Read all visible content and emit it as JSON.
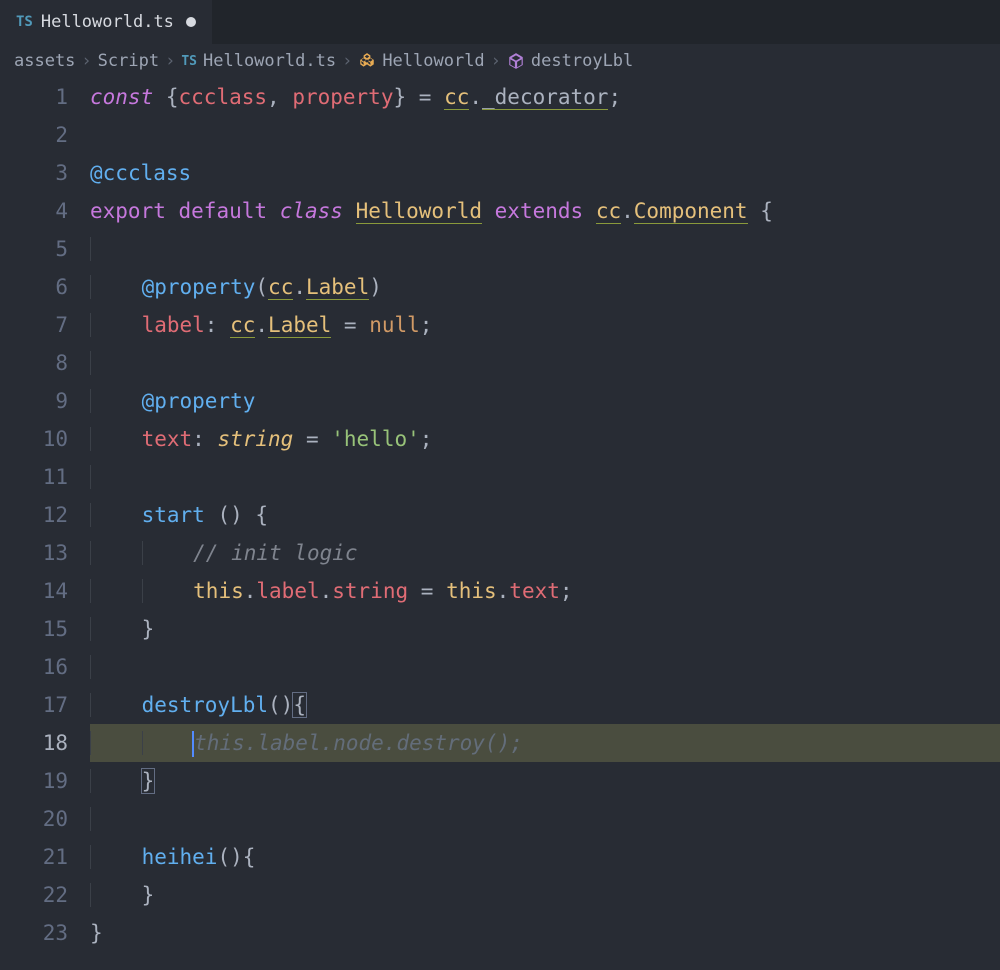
{
  "tab": {
    "badge": "TS",
    "label": "Helloworld.ts",
    "dirty": true
  },
  "breadcrumb": {
    "parts": [
      "assets",
      "Script"
    ],
    "file_badge": "TS",
    "file": "Helloworld.ts",
    "class": "Helloworld",
    "method": "destroyLbl"
  },
  "gutter": {
    "lines": [
      "1",
      "2",
      "3",
      "4",
      "5",
      "6",
      "7",
      "8",
      "9",
      "10",
      "11",
      "12",
      "13",
      "14",
      "15",
      "16",
      "17",
      "18",
      "19",
      "20",
      "21",
      "22",
      "23"
    ],
    "active": 18
  },
  "code": {
    "l1": {
      "const": "const",
      "br_open": " {",
      "ccclass": "ccclass",
      "comma": ", ",
      "property": "property",
      "br_close": "} = ",
      "cc": "cc",
      "dot": ".",
      "dec": "_decorator",
      "semi": ";"
    },
    "l3": {
      "at": "@",
      "ccclass": "ccclass"
    },
    "l4": {
      "export": "export",
      "sp1": " ",
      "default": "default",
      "sp2": " ",
      "class": "class",
      "sp3": " ",
      "name": "Helloworld",
      "sp4": " ",
      "extends": "extends",
      "sp5": " ",
      "cc": "cc",
      "dot": ".",
      "comp": "Component",
      "sp6": " ",
      "brace": "{"
    },
    "l6": {
      "indent": "    ",
      "at": "@",
      "property": "property",
      "open": "(",
      "cc": "cc",
      "dot": ".",
      "label": "Label",
      "close": ")"
    },
    "l7": {
      "indent": "    ",
      "label": "label",
      "colon": ": ",
      "cc": "cc",
      "dot": ".",
      "type": "Label",
      "eq": " = ",
      "null": "null",
      "semi": ";"
    },
    "l9": {
      "indent": "    ",
      "at": "@",
      "property": "property"
    },
    "l10": {
      "indent": "    ",
      "text": "text",
      "colon": ": ",
      "type": "string",
      "eq": " = ",
      "str": "'hello'",
      "semi": ";"
    },
    "l12": {
      "indent": "    ",
      "name": "start",
      "space": " ",
      "parens": "() ",
      "brace": "{"
    },
    "l13": {
      "indent": "        ",
      "comment": "// init logic"
    },
    "l14": {
      "indent": "        ",
      "this": "this",
      "dot1": ".",
      "label": "label",
      "dot2": ".",
      "string": "string",
      "eq": " = ",
      "this2": "this",
      "dot3": ".",
      "text": "text",
      "semi": ";"
    },
    "l15": {
      "indent": "    ",
      "brace": "}"
    },
    "l17": {
      "indent": "    ",
      "name": "destroyLbl",
      "parens": "()",
      "brace": "{"
    },
    "l18": {
      "indent": "        ",
      "ghost": "this.label.node.destroy();"
    },
    "l19": {
      "indent": "    ",
      "brace": "}"
    },
    "l21": {
      "indent": "    ",
      "name": "heihei",
      "parens": "()",
      "brace": "{"
    },
    "l22": {
      "indent": "    ",
      "brace": "}"
    },
    "l23": {
      "brace": "}"
    }
  }
}
